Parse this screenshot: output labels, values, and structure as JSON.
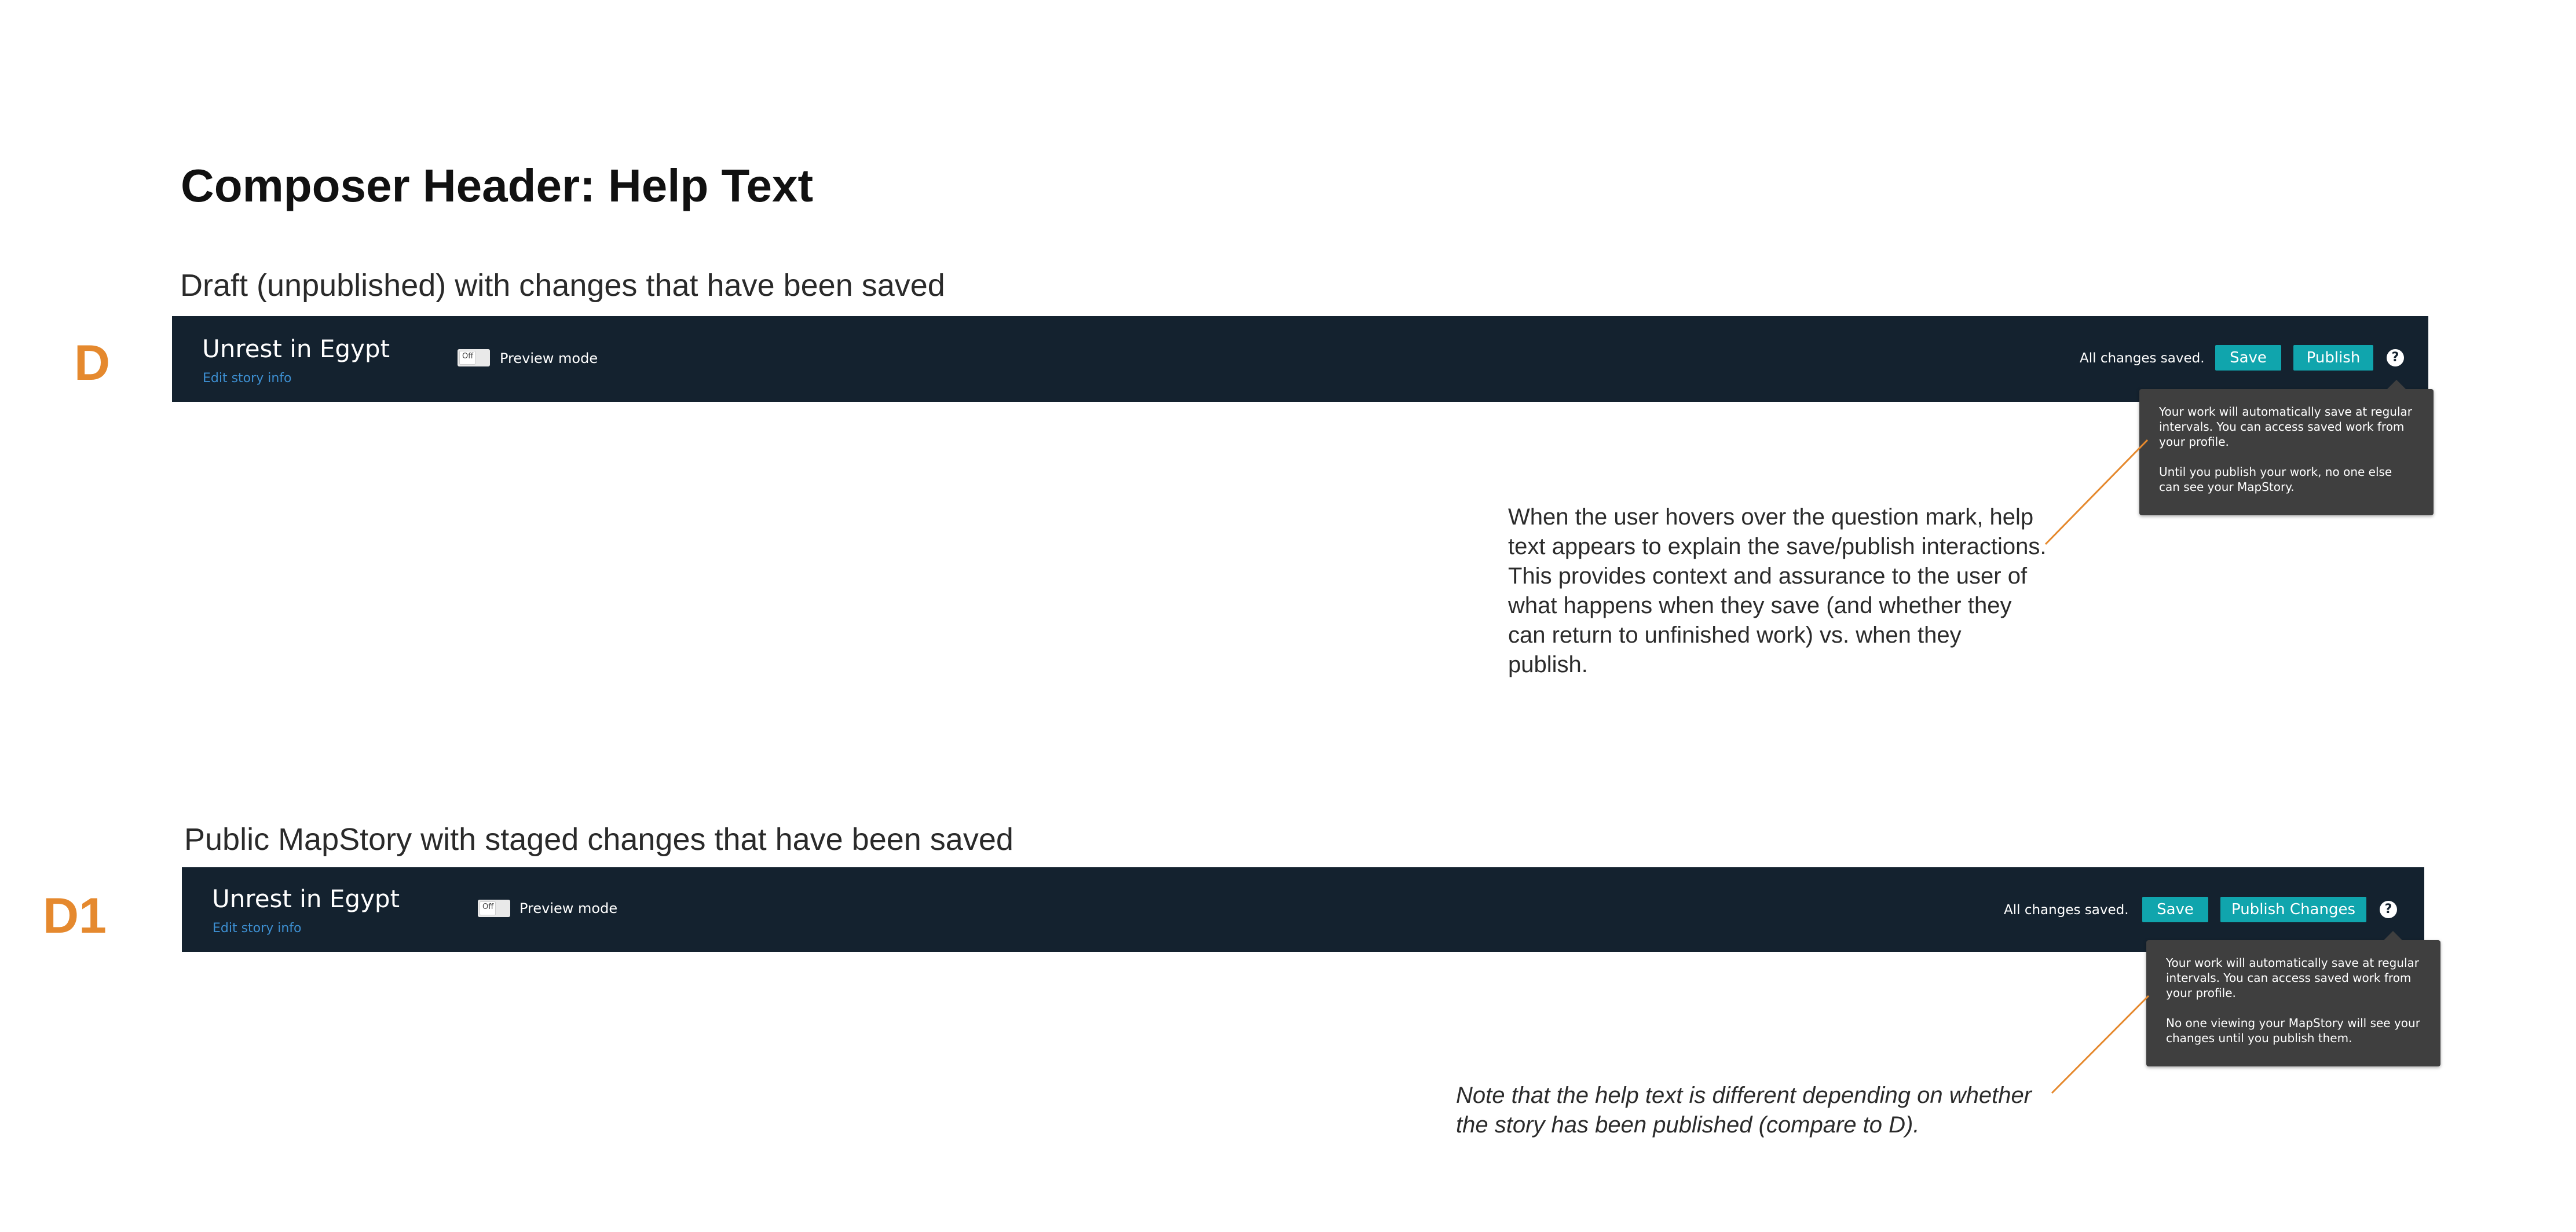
{
  "page": {
    "title": "Composer Header: Help Text"
  },
  "sections": [
    {
      "letter": "D",
      "heading": "Draft (unpublished) with changes that have been saved",
      "header": {
        "story_title": "Unrest in Egypt",
        "edit_link": "Edit story info",
        "toggle_label": "Off",
        "preview_label": "Preview mode",
        "status": "All changes saved.",
        "save_label": "Save",
        "publish_label": "Publish",
        "help_icon": "?"
      },
      "tooltip": {
        "para1": "Your work will automatically save at regular intervals. You can access saved work from your profile.",
        "para2": "Until you publish your work, no one else can see your MapStory."
      },
      "annotation": "When the user hovers over the question mark, help text appears to explain the save/publish interactions. This provides context and assurance to the user of what happens when they save (and whether they can return to unfinished work) vs. when they publish."
    },
    {
      "letter": "D1",
      "heading": "Public MapStory with staged changes that have been saved",
      "header": {
        "story_title": "Unrest in Egypt",
        "edit_link": "Edit story info",
        "toggle_label": "Off",
        "preview_label": "Preview mode",
        "status": "All changes saved.",
        "save_label": "Save",
        "publish_label": "Publish Changes",
        "help_icon": "?"
      },
      "tooltip": {
        "para1": "Your work will automatically save at regular intervals. You can access saved work from your profile.",
        "para2": "No one viewing your MapStory will see your changes until you publish them."
      },
      "annotation": "Note that the help text is different depending on whether the story has been published (compare to D)."
    }
  ],
  "colors": {
    "header_bg": "#14222f",
    "button": "#10a5ad",
    "accent_letter": "#e5892e",
    "link": "#3d8fd1",
    "tooltip_bg": "#3f3f3f",
    "connector": "#e5892e"
  },
  "icons": {
    "help": "question-mark-circle-icon",
    "toggle": "toggle-switch-icon"
  }
}
